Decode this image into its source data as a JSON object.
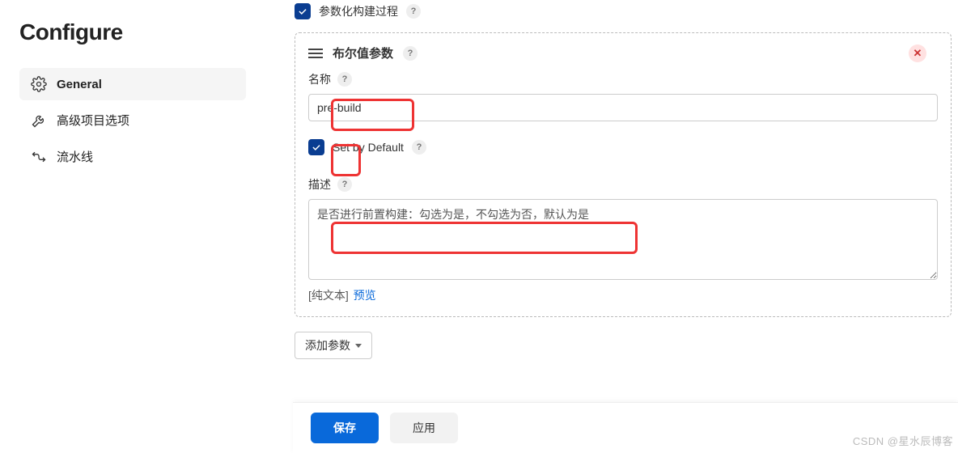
{
  "page_title": "Configure",
  "sidebar": {
    "items": [
      {
        "label": "General",
        "active": true
      },
      {
        "label": "高级项目选项",
        "active": false
      },
      {
        "label": "流水线",
        "active": false
      }
    ]
  },
  "top_checkbox": {
    "label": "参数化构建过程",
    "checked": true
  },
  "param_panel": {
    "title": "布尔值参数",
    "name_label": "名称",
    "name_value": "pre-build",
    "set_default_label": "Set by Default",
    "set_default_checked": true,
    "description_label": "描述",
    "description_value": "是否进行前置构建：勾选为是，不勾选为否，默认为是",
    "format_plain": "[纯文本]",
    "format_preview": "预览"
  },
  "add_param_label": "添加参数",
  "footer": {
    "save": "保存",
    "apply": "应用"
  },
  "watermark": "CSDN @星水辰博客"
}
